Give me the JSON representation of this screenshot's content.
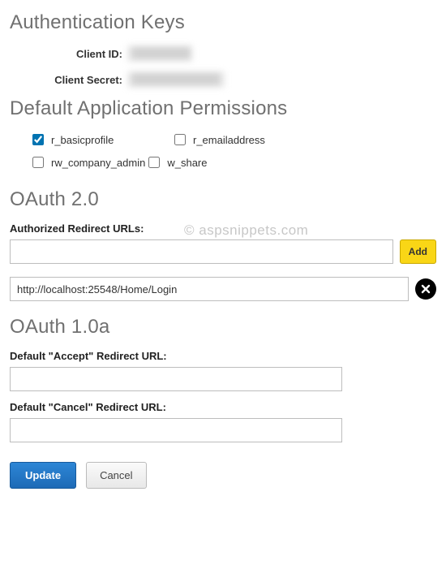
{
  "authKeys": {
    "heading": "Authentication Keys",
    "clientIdLabel": "Client ID:",
    "clientIdValue": "████████",
    "clientSecretLabel": "Client Secret:",
    "clientSecretValue": "████████████"
  },
  "permissions": {
    "heading": "Default Application Permissions",
    "items": [
      {
        "key": "r_basicprofile",
        "label": "r_basicprofile",
        "checked": true
      },
      {
        "key": "r_emailaddress",
        "label": "r_emailaddress",
        "checked": false
      },
      {
        "key": "rw_company_admin",
        "label": "rw_company_admin",
        "checked": false
      },
      {
        "key": "w_share",
        "label": "w_share",
        "checked": false
      }
    ]
  },
  "oauth2": {
    "heading": "OAuth 2.0",
    "authorizedLabel": "Authorized Redirect URLs:",
    "watermark": "© aspsnippets.com",
    "newUrlValue": "",
    "addLabel": "Add",
    "urls": [
      "http://localhost:25548/Home/Login"
    ]
  },
  "oauth1": {
    "heading": "OAuth 1.0a",
    "acceptLabel": "Default \"Accept\" Redirect URL:",
    "acceptValue": "",
    "cancelLabel": "Default \"Cancel\" Redirect URL:",
    "cancelValue": ""
  },
  "actions": {
    "updateLabel": "Update",
    "cancelLabel": "Cancel"
  }
}
